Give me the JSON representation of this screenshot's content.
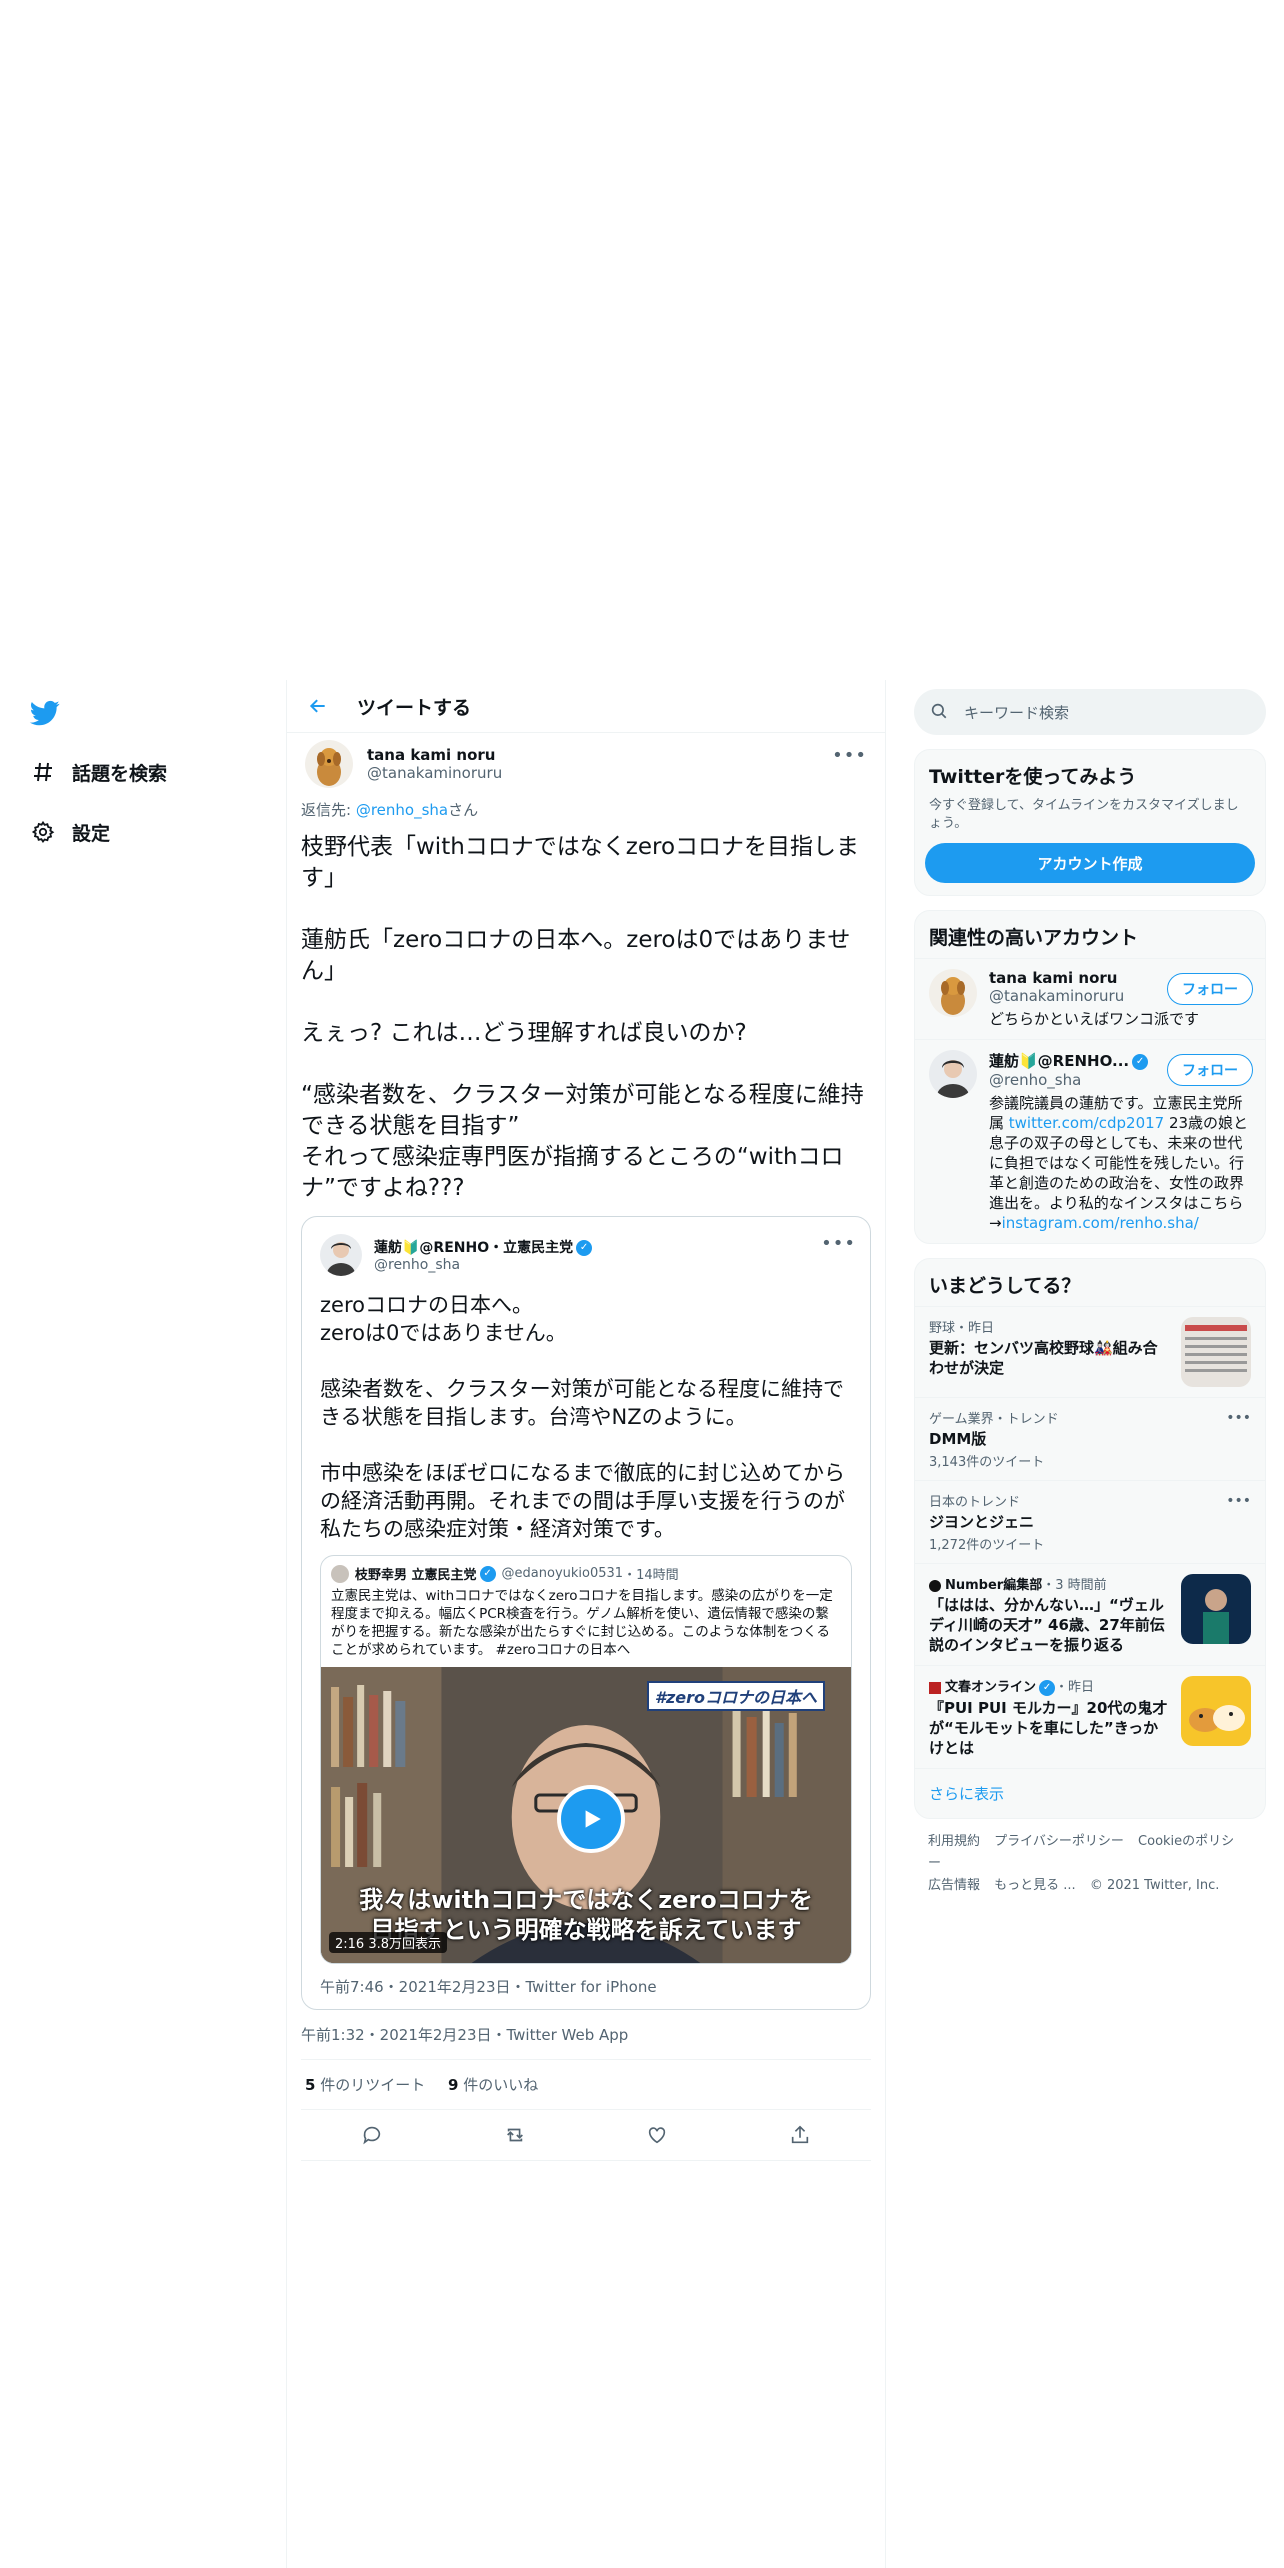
{
  "nav": {
    "items": [
      {
        "label": "話題を検索",
        "icon": "hashtag-icon"
      },
      {
        "label": "設定",
        "icon": "gear-icon"
      }
    ]
  },
  "header": {
    "title": "ツイートする"
  },
  "tweet": {
    "author_name": "tana kami noru",
    "author_handle": "@tanakaminoruru",
    "reply_prefix": "返信先: ",
    "reply_handle": "@renho_sha",
    "reply_suffix": "さん",
    "text": "枝野代表「withコロナではなくzeroコロナを目指します」\n\n蓮舫氏「zeroコロナの日本へ。zeroは0ではありません」\n\nえぇっ? これは…どう理解すれば良いのか?\n\n“感染者数を、クラスター対策が可能となる程度に維持できる状態を目指す”\nそれって感染症専門医が指摘するところの“withコロナ”ですよね???",
    "meta": "午前1:32・2021年2月23日・Twitter Web App",
    "retweets": "5",
    "retweets_label": " 件のリツイート",
    "likes": "9",
    "likes_label": " 件のいいね"
  },
  "quote": {
    "author_name": "蓮舫🔰@RENHO・立憲民主党",
    "author_handle": "@renho_sha",
    "text": "zeroコロナの日本へ。\nzeroは0ではありません。\n\n感染者数を、クラスター対策が可能となる程度に維持できる状態を目指します。台湾やNZのように。\n\n市中感染をほぼゼロになるまで徹底的に封じ込めてからの経済活動再開。それまでの間は手厚い支援を行うのが私たちの感染症対策・経済対策です。",
    "meta": "午前7:46・2021年2月23日・Twitter for iPhone",
    "inner": {
      "author_name": "枝野幸男 立憲民主党",
      "author_handle": "@edanoyukio0531",
      "time": "・14時間",
      "text": "立憲民主党は、withコロナではなくzeroコロナを目指します。感染の広がりを一定程度まで抑える。幅広くPCR検査を行う。ゲノム解析を使い、遺伝情報で感染の繋がりを把握する。新たな感染が出たらすぐに封じ込める。このような体制をつくることが求められています。 #zeroコロナの日本へ",
      "video_tag": "#zeroコロナの日本へ",
      "video_caption_1": "我々はwithコロナではなくzeroコロナを",
      "video_caption_2": "目指すという明確な戦略を訴えています",
      "duration": "2:16",
      "views": "3.8万回表示"
    }
  },
  "search": {
    "placeholder": "キーワード検索"
  },
  "signup_card": {
    "title": "Twitterを使ってみよう",
    "subtitle": "今すぐ登録して、タイムラインをカスタマイズしましょう。",
    "button": "アカウント作成"
  },
  "related": {
    "title": "関連性の高いアカウント",
    "follow_label": "フォロー",
    "accounts": [
      {
        "name": "tana kami noru",
        "handle": "@tanakaminoruru",
        "bio": "どちらかといえばワンコ派です"
      },
      {
        "name": "蓮舫🔰@RENHO...",
        "handle": "@renho_sha",
        "bio_1": "参議院議員の蓮舫です。立憲民主党所属 ",
        "bio_link_1": "twitter.com/cdp2017",
        "bio_2": " 23歳の娘と息子の双子の母としても、未来の世代に負担ではなく可能性を残したい。行革と創造のための政治を、女性の政界進出を。より私的なインスタはこちら→",
        "bio_link_2": "instagram.com/renho.sha/"
      }
    ]
  },
  "trends": {
    "title": "いまどうしてる？",
    "items": [
      {
        "context": "野球・昨日",
        "title": "更新：センバツ高校野球🎎組み合わせが決定",
        "count": ""
      },
      {
        "context": "ゲーム業界・トレンド",
        "title": "DMM版",
        "count": "3,143件のツイート"
      },
      {
        "context": "日本のトレンド",
        "title": "ジヨンとジェニ",
        "count": "1,272件のツイート"
      },
      {
        "context": "Number編集部",
        "context_suffix": "・3 時間前",
        "title": "「ははは、分かんない…」“ヴェルディ川崎の天才” 46歳、27年前伝説のインタビューを振り返る",
        "count": ""
      },
      {
        "context": "文春オンライン",
        "context_suffix": "・昨日",
        "title": "『PUI PUI モルカー』20代の鬼才が“モルモットを車にした”きっかけとは",
        "count": ""
      }
    ],
    "show_more": "さらに表示"
  },
  "footer": {
    "links": [
      "利用規約",
      "プライバシーポリシー",
      "Cookieのポリシー",
      "広告情報",
      "もっと見る ..."
    ],
    "copyright": "© 2021 Twitter, Inc."
  },
  "colors": {
    "accent": "#1d9bf0",
    "text": "#0f1419",
    "secondary": "#536471"
  }
}
